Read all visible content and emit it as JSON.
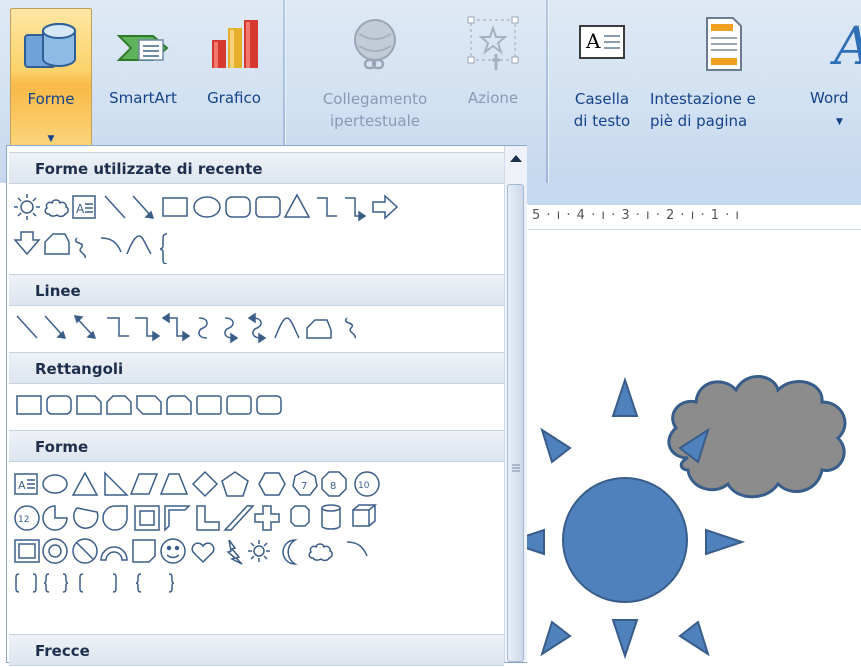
{
  "ribbon": {
    "buttons": [
      {
        "label": "Forme",
        "icon": "shapes-icon"
      },
      {
        "label": "SmartArt",
        "icon": "smartart-icon"
      },
      {
        "label": "Grafico",
        "icon": "chart-icon"
      },
      {
        "label": "Collegamento\nipertestuale",
        "icon": "hyperlink-globe-icon"
      },
      {
        "label": "Azione",
        "icon": "action-star-icon"
      },
      {
        "label": "Casella\ndi testo",
        "icon": "textbox-icon"
      },
      {
        "label": "Intestazione e\npiè di pagina",
        "icon": "header-footer-icon"
      },
      {
        "label": "Word",
        "icon": "wordart-icon"
      }
    ]
  },
  "dropdown": {
    "sections": [
      {
        "title": "Forme utilizzate di recente"
      },
      {
        "title": "Linee"
      },
      {
        "title": "Rettangoli"
      },
      {
        "title": "Forme"
      },
      {
        "title": "Frecce"
      }
    ]
  },
  "ruler": {
    "text": "5 · ı · 4 · ı · 3 · ı · 2 · ı · 1 · ı"
  },
  "colors": {
    "shape_fill": "#4f81bd",
    "cloud_fill": "#8c8c8c",
    "shape_stroke": "#385d8a"
  }
}
